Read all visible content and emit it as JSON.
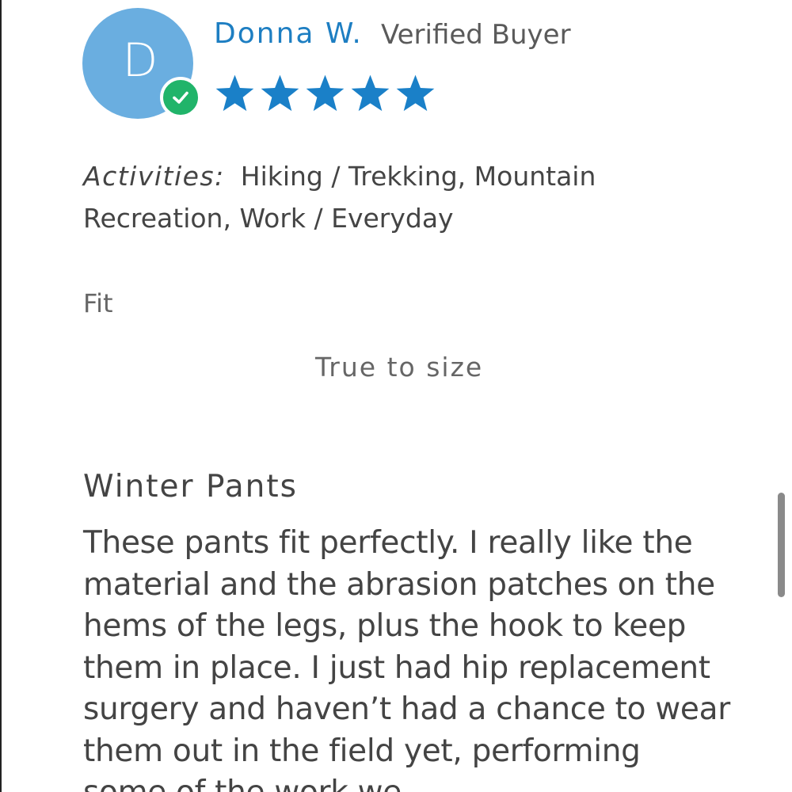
{
  "reviewer": {
    "avatar_initial": "D",
    "name": "Donna W.",
    "status": "Verified Buyer",
    "rating": 5,
    "rating_max": 5
  },
  "activities": {
    "label": "Activities:",
    "value": "Hiking / Trekking, Mountain Recreation, Work / Everyday"
  },
  "fit": {
    "label": "Fit",
    "value": "True to size"
  },
  "review": {
    "title": "Winter Pants",
    "body": "These pants fit perfectly. I really like the material and the abrasion patches on the hems of the legs, plus the hook to keep them in place. I just had hip replacement surgery and haven’t had a chance to wear them out in the field yet, performing some of the work we"
  },
  "icons": {
    "verified": "check-circle-icon",
    "star": "star-icon"
  },
  "colors": {
    "avatar": "#6aaee0",
    "name": "#1d7ec2",
    "star": "#1a80c8",
    "verified_badge": "#21b46a"
  }
}
